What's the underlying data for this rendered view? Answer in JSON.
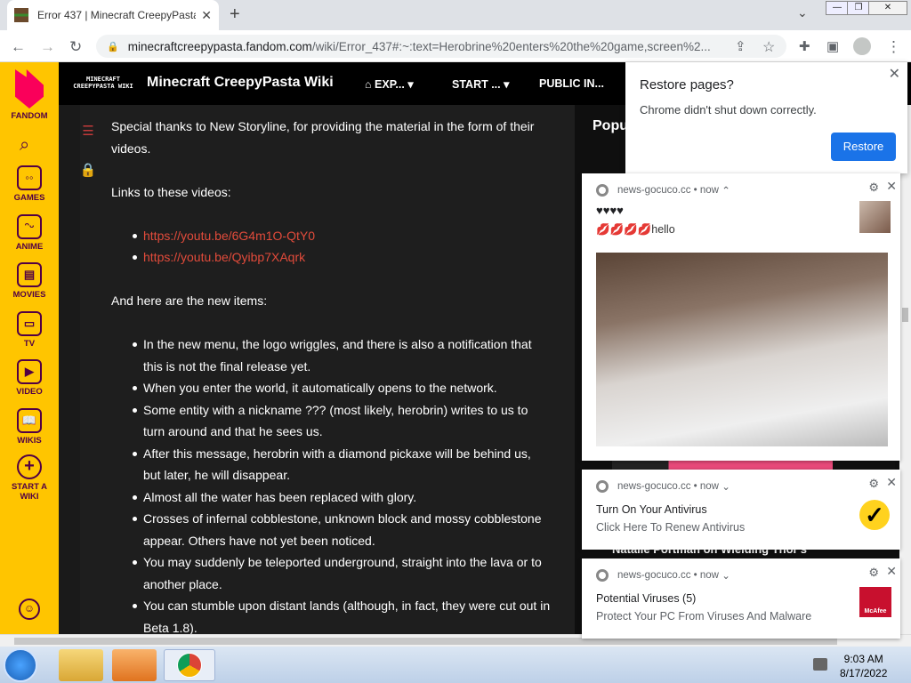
{
  "browser": {
    "tab_title": "Error 437 | Minecraft CreepyPasta",
    "url_host": "minecraftcreepypasta.fandom.com",
    "url_rest": "/wiki/Error_437#:~:text=Herobrine%20enters%20the%20game,screen%2..."
  },
  "rail": {
    "brand": "FANDOM",
    "items": [
      "GAMES",
      "ANIME",
      "MOVIES",
      "TV",
      "VIDEO",
      "WIKIS"
    ],
    "start_wiki_line1": "START A",
    "start_wiki_line2": "WIKI"
  },
  "site": {
    "logo_line1": "MINECRAFT",
    "logo_line2": "CREEPYPASTA WIKI",
    "name": "Minecraft CreepyPasta Wiki",
    "nav": [
      "EXP...",
      "START ...",
      "PUBLIC IN..."
    ]
  },
  "article": {
    "p1": "Special thanks to New Storyline, for providing the material in the form of their videos.",
    "p2": "Links to these videos:",
    "links": [
      "https://youtu.be/6G4m1O-QtY0",
      "https://youtu.be/Qyibp7XAqrk"
    ],
    "p3": "And here are the new items:",
    "items": [
      "In the new menu, the logo wriggles, and there is also a notification that this is not the final release yet.",
      "When you enter the world, it automatically opens to the network.",
      "Some entity with a nickname ??? (most likely, herobrin) writes to us to turn around and that he sees us.",
      "After this message, herobrin with a diamond pickaxe will be behind us, but later, he will disappear.",
      "Almost all the water has been replaced with glory.",
      "Crosses of infernal cobblestone, unknown block and mossy cobblestone appear. Others have not yet been noticed.",
      "You may suddenly be teleported underground, straight into the lava or to another place.",
      "You can stumble upon distant lands (although, in fact, they were cut out in Beta 1.8)."
    ]
  },
  "sidebar": {
    "heading": "Popu",
    "card_title": "Natalie Portman on Wielding Thor's"
  },
  "restore_popup": {
    "title": "Restore pages?",
    "desc": "Chrome didn't shut down correctly.",
    "button": "Restore"
  },
  "notifications": [
    {
      "source": "news-gocuco.cc",
      "time": "now",
      "title": "♥♥♥♥",
      "body": "💋💋💋💋hello"
    },
    {
      "source": "news-gocuco.cc",
      "time": "now",
      "title": "Turn On Your Antivirus",
      "body": "Click Here To Renew Antivirus"
    },
    {
      "source": "news-gocuco.cc",
      "time": "now",
      "title": "Potential Viruses (5)",
      "body": "Protect Your PC From Viruses And Malware",
      "badge": "McAfee"
    }
  ],
  "taskbar": {
    "time": "9:03 AM",
    "date": "8/17/2022"
  }
}
